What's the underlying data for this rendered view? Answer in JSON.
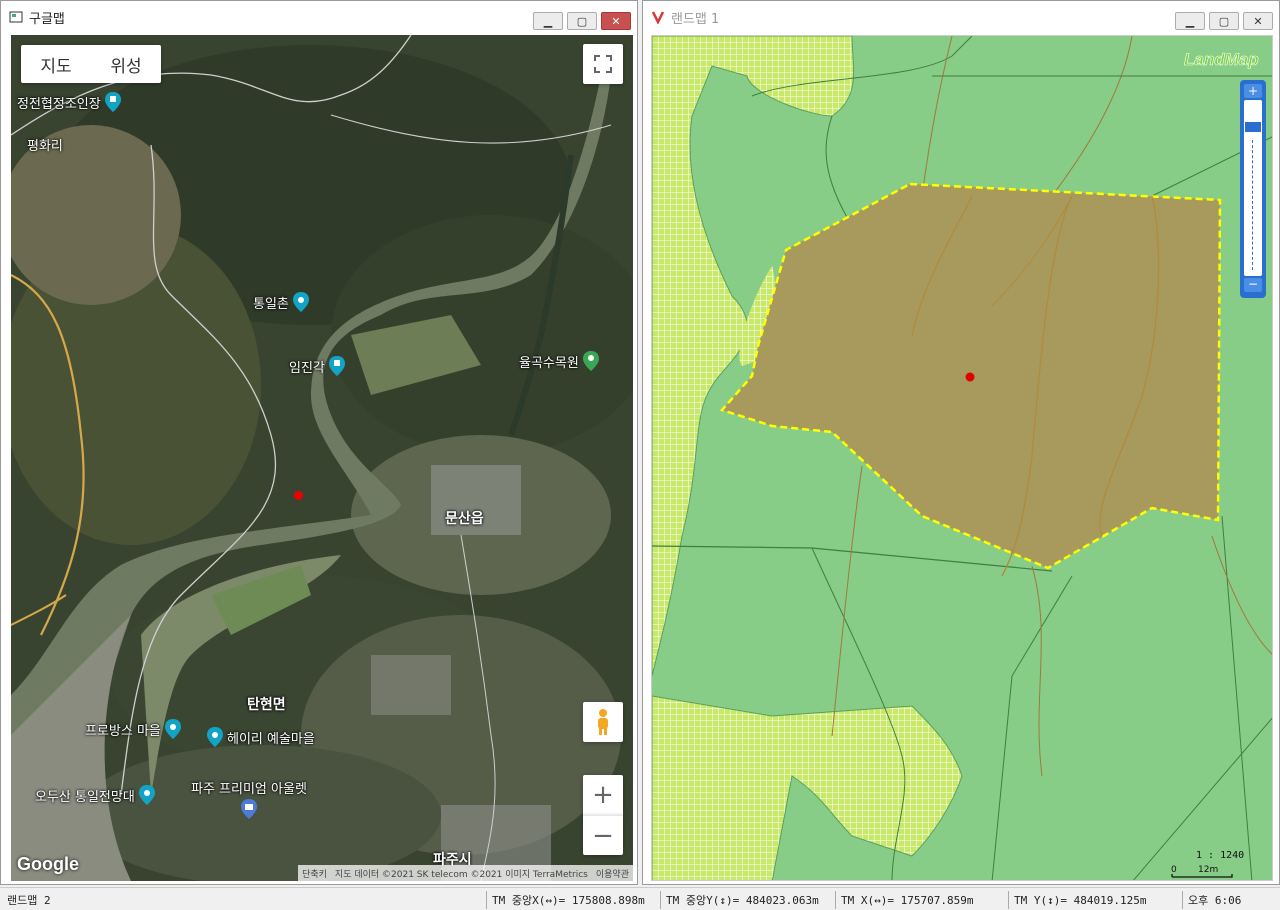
{
  "left_window": {
    "title": "구글맵",
    "map_type": {
      "map": "지도",
      "satellite": "위성"
    },
    "places": [
      {
        "label": "정전협정조인장",
        "icon": "landmark-pin-icon"
      },
      {
        "label": "평화리",
        "icon": ""
      },
      {
        "label": "통일촌",
        "icon": "camera-pin-icon"
      },
      {
        "label": "임진각",
        "icon": "landmark-pin-icon"
      },
      {
        "label": "율곡수목원",
        "icon": "garden-pin-icon"
      },
      {
        "label": "문산읍",
        "icon": ""
      },
      {
        "label": "탄현면",
        "icon": ""
      },
      {
        "label": "프로방스 마을",
        "icon": "camera-pin-icon"
      },
      {
        "label": "헤이리 예술마을",
        "icon": "camera-pin-icon"
      },
      {
        "label": "오두산 통일전망대",
        "icon": "camera-pin-icon"
      },
      {
        "label": "파주 프리미엄 아울렛",
        "icon": "shopping-pin-icon"
      },
      {
        "label": "파주시",
        "icon": ""
      }
    ],
    "google_logo": "Google",
    "credits": {
      "shortcuts": "단축키",
      "data": "지도 데이터 ©2021 SK telecom ©2021 이미지 TerraMetrics",
      "terms": "이용약관"
    }
  },
  "right_window": {
    "title": "랜드맵 1",
    "logo": "LandMap",
    "scale_ratio": "1 : 1240",
    "scale_zero": "0",
    "scale_len": "12m"
  },
  "status": {
    "app": "랜드맵 2",
    "tm_center_x": "TM 중앙X(↔)= 175808.898m",
    "tm_center_y": "TM 중앙Y(↕)= 484023.063m",
    "tm_x": "TM X(↔)= 175707.859m",
    "tm_y": "TM Y(↕)= 484019.125m",
    "time": "오후 6:06"
  },
  "colors": {
    "parcel_border": "#ffff00",
    "parcel_fill": "#a89a5c",
    "land_green": "#87cc87",
    "marker": "#e00000"
  }
}
